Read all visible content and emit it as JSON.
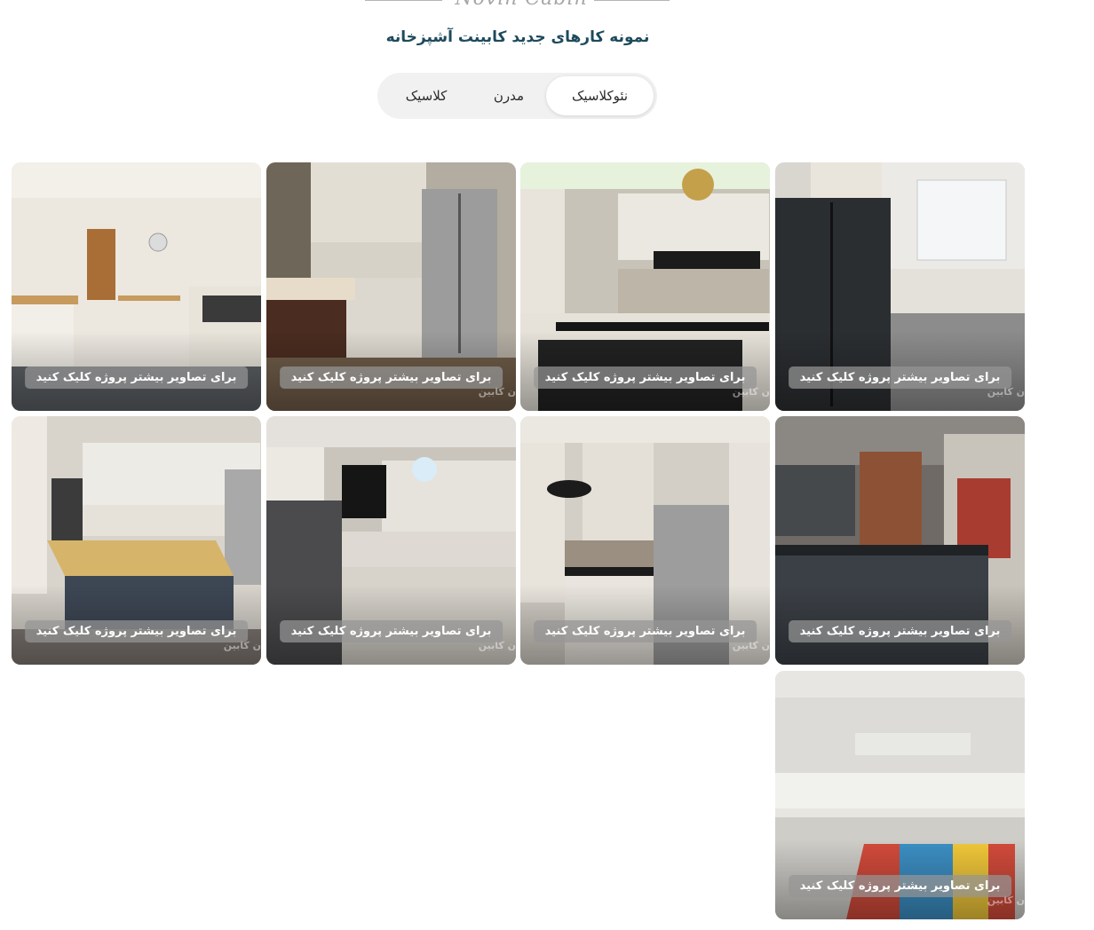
{
  "header": {
    "brand": "Novin Cabin",
    "title": "نمونه کارهای جدید کابینت آشپزخانه"
  },
  "tabs": [
    {
      "label": "نئوکلاسیک",
      "active": true
    },
    {
      "label": "مدرن",
      "active": false
    },
    {
      "label": "کلاسیک",
      "active": false
    }
  ],
  "gallery": {
    "cta_label": "برای تصاویر بیشتر پروژه کلیک کنید",
    "watermark": "ن کابین"
  }
}
